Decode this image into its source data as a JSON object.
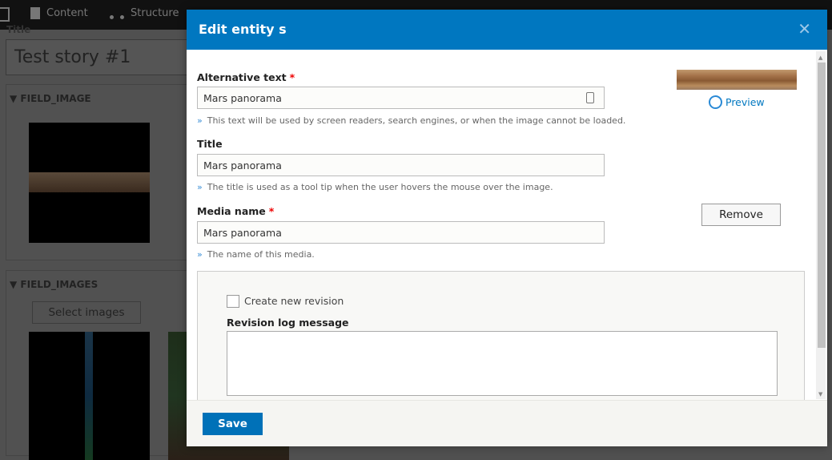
{
  "background": {
    "toolbar": {
      "items": [
        {
          "label": "Content"
        },
        {
          "label": "Structure"
        }
      ]
    },
    "title_label": "Title",
    "title_value": "Test story #1",
    "field_image": {
      "label": "FIELD_IMAGE"
    },
    "field_images": {
      "label": "FIELD_IMAGES",
      "select_button": "Select images"
    }
  },
  "modal": {
    "title": "Edit entity s",
    "close_icon": "close-icon",
    "alt_text": {
      "label": "Alternative text",
      "required": "*",
      "value": "Mars panorama",
      "help": "This text will be used by screen readers, search engines, or when the image cannot be loaded."
    },
    "title_field": {
      "label": "Title",
      "value": "Mars panorama",
      "help": "The title is used as a tool tip when the user hovers the mouse over the image."
    },
    "media_name": {
      "label": "Media name",
      "required": "*",
      "value": "Mars panorama",
      "help": "The name of this media."
    },
    "preview_link": "Preview",
    "remove_button": "Remove",
    "revision": {
      "checkbox_label": "Create new revision",
      "checked": false,
      "log_label": "Revision log message",
      "log_value": ""
    },
    "save_button": "Save",
    "help_marker": "»"
  },
  "colors": {
    "header": "#0077c0",
    "save": "#0071b8",
    "required": "#e00000"
  }
}
